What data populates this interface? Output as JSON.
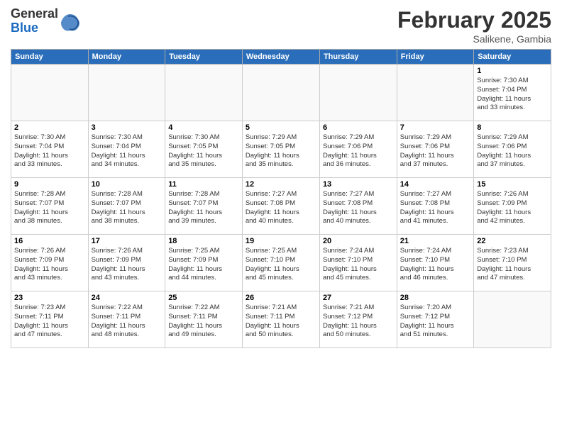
{
  "logo": {
    "general": "General",
    "blue": "Blue"
  },
  "header": {
    "title": "February 2025",
    "subtitle": "Salikene, Gambia"
  },
  "weekdays": [
    "Sunday",
    "Monday",
    "Tuesday",
    "Wednesday",
    "Thursday",
    "Friday",
    "Saturday"
  ],
  "weeks": [
    [
      {
        "day": "",
        "info": ""
      },
      {
        "day": "",
        "info": ""
      },
      {
        "day": "",
        "info": ""
      },
      {
        "day": "",
        "info": ""
      },
      {
        "day": "",
        "info": ""
      },
      {
        "day": "",
        "info": ""
      },
      {
        "day": "1",
        "info": "Sunrise: 7:30 AM\nSunset: 7:04 PM\nDaylight: 11 hours\nand 33 minutes."
      }
    ],
    [
      {
        "day": "2",
        "info": "Sunrise: 7:30 AM\nSunset: 7:04 PM\nDaylight: 11 hours\nand 33 minutes."
      },
      {
        "day": "3",
        "info": "Sunrise: 7:30 AM\nSunset: 7:04 PM\nDaylight: 11 hours\nand 34 minutes."
      },
      {
        "day": "4",
        "info": "Sunrise: 7:30 AM\nSunset: 7:05 PM\nDaylight: 11 hours\nand 35 minutes."
      },
      {
        "day": "5",
        "info": "Sunrise: 7:29 AM\nSunset: 7:05 PM\nDaylight: 11 hours\nand 35 minutes."
      },
      {
        "day": "6",
        "info": "Sunrise: 7:29 AM\nSunset: 7:06 PM\nDaylight: 11 hours\nand 36 minutes."
      },
      {
        "day": "7",
        "info": "Sunrise: 7:29 AM\nSunset: 7:06 PM\nDaylight: 11 hours\nand 37 minutes."
      },
      {
        "day": "8",
        "info": "Sunrise: 7:29 AM\nSunset: 7:06 PM\nDaylight: 11 hours\nand 37 minutes."
      }
    ],
    [
      {
        "day": "9",
        "info": "Sunrise: 7:28 AM\nSunset: 7:07 PM\nDaylight: 11 hours\nand 38 minutes."
      },
      {
        "day": "10",
        "info": "Sunrise: 7:28 AM\nSunset: 7:07 PM\nDaylight: 11 hours\nand 38 minutes."
      },
      {
        "day": "11",
        "info": "Sunrise: 7:28 AM\nSunset: 7:07 PM\nDaylight: 11 hours\nand 39 minutes."
      },
      {
        "day": "12",
        "info": "Sunrise: 7:27 AM\nSunset: 7:08 PM\nDaylight: 11 hours\nand 40 minutes."
      },
      {
        "day": "13",
        "info": "Sunrise: 7:27 AM\nSunset: 7:08 PM\nDaylight: 11 hours\nand 40 minutes."
      },
      {
        "day": "14",
        "info": "Sunrise: 7:27 AM\nSunset: 7:08 PM\nDaylight: 11 hours\nand 41 minutes."
      },
      {
        "day": "15",
        "info": "Sunrise: 7:26 AM\nSunset: 7:09 PM\nDaylight: 11 hours\nand 42 minutes."
      }
    ],
    [
      {
        "day": "16",
        "info": "Sunrise: 7:26 AM\nSunset: 7:09 PM\nDaylight: 11 hours\nand 43 minutes."
      },
      {
        "day": "17",
        "info": "Sunrise: 7:26 AM\nSunset: 7:09 PM\nDaylight: 11 hours\nand 43 minutes."
      },
      {
        "day": "18",
        "info": "Sunrise: 7:25 AM\nSunset: 7:09 PM\nDaylight: 11 hours\nand 44 minutes."
      },
      {
        "day": "19",
        "info": "Sunrise: 7:25 AM\nSunset: 7:10 PM\nDaylight: 11 hours\nand 45 minutes."
      },
      {
        "day": "20",
        "info": "Sunrise: 7:24 AM\nSunset: 7:10 PM\nDaylight: 11 hours\nand 45 minutes."
      },
      {
        "day": "21",
        "info": "Sunrise: 7:24 AM\nSunset: 7:10 PM\nDaylight: 11 hours\nand 46 minutes."
      },
      {
        "day": "22",
        "info": "Sunrise: 7:23 AM\nSunset: 7:10 PM\nDaylight: 11 hours\nand 47 minutes."
      }
    ],
    [
      {
        "day": "23",
        "info": "Sunrise: 7:23 AM\nSunset: 7:11 PM\nDaylight: 11 hours\nand 47 minutes."
      },
      {
        "day": "24",
        "info": "Sunrise: 7:22 AM\nSunset: 7:11 PM\nDaylight: 11 hours\nand 48 minutes."
      },
      {
        "day": "25",
        "info": "Sunrise: 7:22 AM\nSunset: 7:11 PM\nDaylight: 11 hours\nand 49 minutes."
      },
      {
        "day": "26",
        "info": "Sunrise: 7:21 AM\nSunset: 7:11 PM\nDaylight: 11 hours\nand 50 minutes."
      },
      {
        "day": "27",
        "info": "Sunrise: 7:21 AM\nSunset: 7:12 PM\nDaylight: 11 hours\nand 50 minutes."
      },
      {
        "day": "28",
        "info": "Sunrise: 7:20 AM\nSunset: 7:12 PM\nDaylight: 11 hours\nand 51 minutes."
      },
      {
        "day": "",
        "info": ""
      }
    ]
  ]
}
